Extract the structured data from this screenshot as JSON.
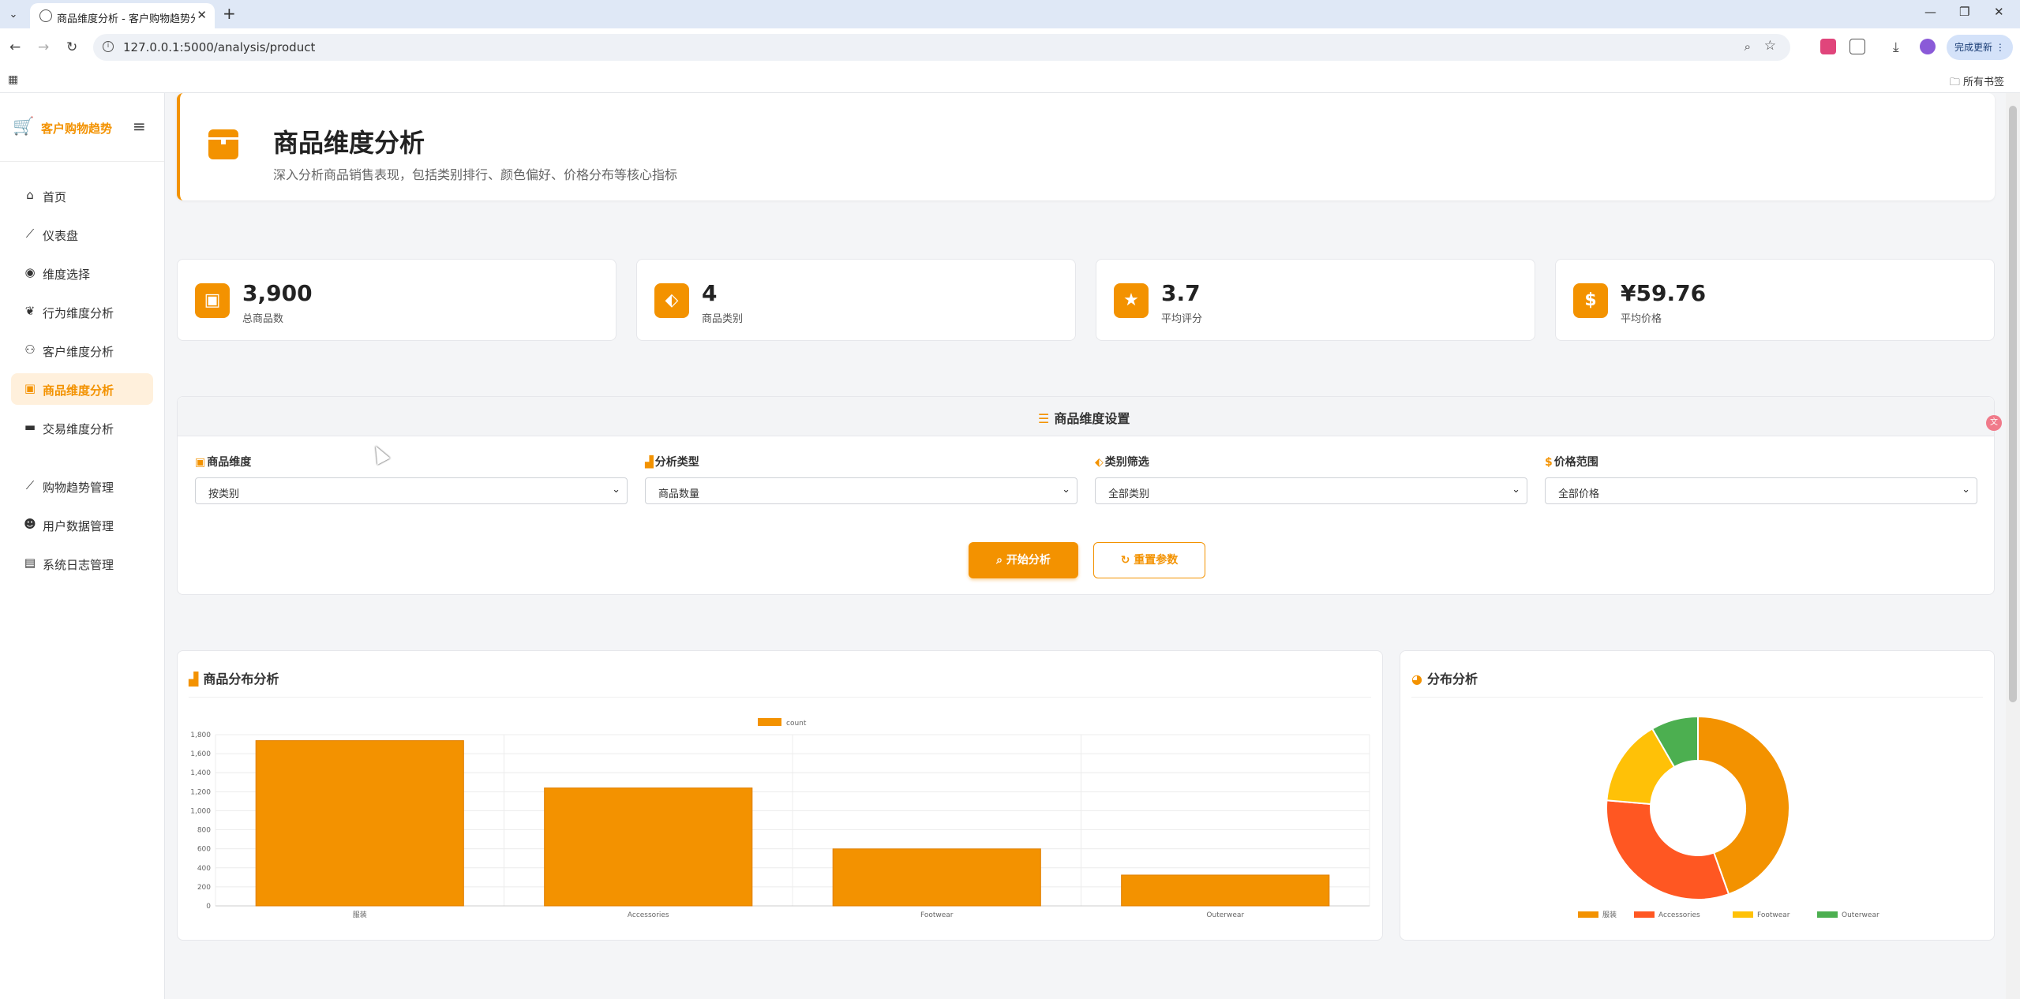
{
  "browser": {
    "tab_title": "商品维度分析 - 客户购物趋势分析",
    "url": "127.0.0.1:5000/analysis/product",
    "update_label": "完成更新",
    "bookmarks_label": "所有书签"
  },
  "sidebar": {
    "brand": "客户购物趋势",
    "items": [
      {
        "label": "首页",
        "icon": "home-icon"
      },
      {
        "label": "仪表盘",
        "icon": "chart-line-icon"
      },
      {
        "label": "维度选择",
        "icon": "compass-icon"
      },
      {
        "label": "行为维度分析",
        "icon": "brain-icon"
      },
      {
        "label": "客户维度分析",
        "icon": "users-icon"
      },
      {
        "label": "商品维度分析",
        "icon": "box-icon"
      },
      {
        "label": "交易维度分析",
        "icon": "credit-card-icon"
      },
      {
        "label": "购物趋势管理",
        "icon": "chart-line-icon"
      },
      {
        "label": "用户数据管理",
        "icon": "user-gear-icon"
      },
      {
        "label": "系统日志管理",
        "icon": "clipboard-icon"
      }
    ],
    "active_index": 5
  },
  "header": {
    "title": "商品维度分析",
    "subtitle": "深入分析商品销售表现，包括类别排行、颜色偏好、价格分布等核心指标"
  },
  "stats": [
    {
      "value": "3,900",
      "label": "总商品数",
      "icon": "box-icon"
    },
    {
      "value": "4",
      "label": "商品类别",
      "icon": "tags-icon"
    },
    {
      "value": "3.7",
      "label": "平均评分",
      "icon": "star-icon"
    },
    {
      "value": "¥59.76",
      "label": "平均价格",
      "icon": "dollar-icon"
    }
  ],
  "settings": {
    "title": "商品维度设置",
    "fields": [
      {
        "label": "商品维度",
        "value": "按类别"
      },
      {
        "label": "分析类型",
        "value": "商品数量"
      },
      {
        "label": "类别筛选",
        "value": "全部类别"
      },
      {
        "label": "价格范围",
        "value": "全部价格"
      }
    ],
    "start_label": "开始分析",
    "reset_label": "重置参数"
  },
  "charts": {
    "bar_title": "商品分布分析",
    "pie_title": "分布分析"
  },
  "colors": {
    "accent": "#f39200",
    "pie": [
      "#f39200",
      "#ff5722",
      "#ffc107",
      "#4caf50"
    ]
  },
  "chart_data": [
    {
      "type": "bar",
      "categories": [
        "服装",
        "Accessories",
        "Footwear",
        "Outerwear"
      ],
      "series": [
        {
          "name": "count",
          "values": [
            1737,
            1240,
            599,
            324
          ]
        }
      ],
      "ylim": [
        0,
        1800
      ],
      "yticks": [
        "0",
        "200",
        "400",
        "600",
        "800",
        "1,000",
        "1,200",
        "1,400",
        "1,600",
        "1,800"
      ],
      "grid": true,
      "legend": "top"
    },
    {
      "type": "pie",
      "categories": [
        "服装",
        "Accessories",
        "Footwear",
        "Outerwear"
      ],
      "values": [
        1737,
        1240,
        599,
        324
      ],
      "donut": true,
      "legend": "bottom"
    }
  ]
}
